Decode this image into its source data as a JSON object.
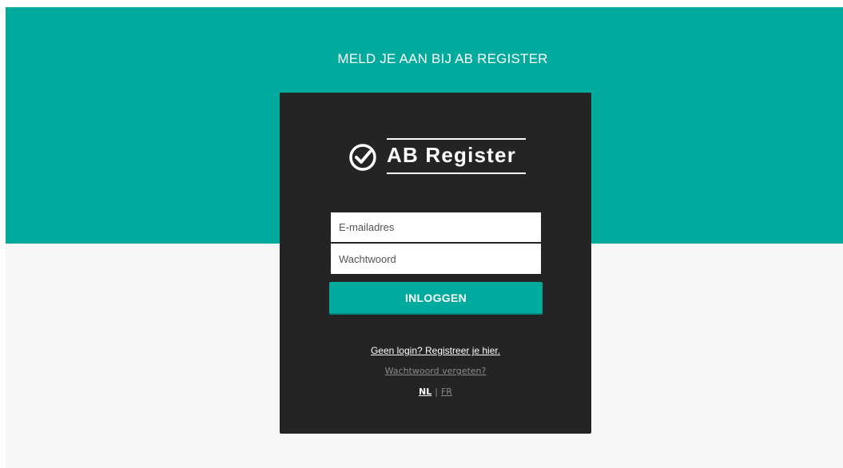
{
  "hero": {
    "heading": "MELD JE AAN BIJ AB REGISTER",
    "color": "#00aa9d"
  },
  "logo": {
    "text": "AB Register",
    "icon": "check-circle-icon"
  },
  "form": {
    "email_placeholder": "E-mailadres",
    "password_placeholder": "Wachtwoord",
    "login_label": "INLOGGEN"
  },
  "links": {
    "register": "Geen login? Registreer je hier.",
    "forgot": "Wachtwoord vergeten?"
  },
  "languages": {
    "active": "NL",
    "separator": "|",
    "other": "FR"
  }
}
